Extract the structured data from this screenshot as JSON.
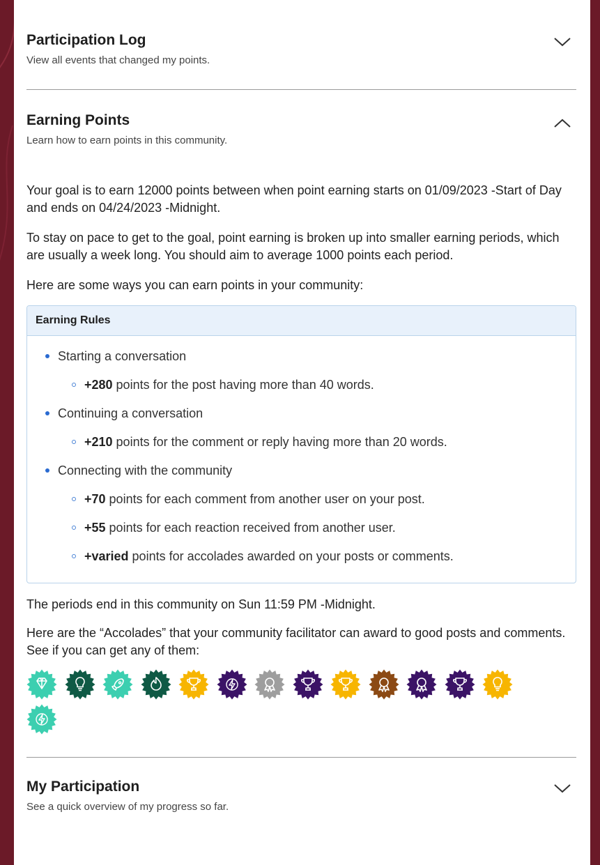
{
  "participation_log": {
    "title": "Participation Log",
    "subtitle": "View all events that changed my points.",
    "state": "collapsed"
  },
  "earning_points": {
    "title": "Earning Points",
    "subtitle": "Learn how to earn points in this community.",
    "state": "expanded",
    "paragraphs": [
      "Your goal is to earn 12000 points between when point earning starts on 01/09/2023 -Start of Day and ends on 04/24/2023 -Midnight.",
      "To stay on pace to get to the goal, point earning is broken up into smaller earning periods, which are usually a week long. You should aim to average 1000 points each period.",
      "Here are some ways you can earn points in your community:"
    ],
    "rules_title": "Earning Rules",
    "rules": [
      {
        "label": "Starting a conversation",
        "items": [
          {
            "amount": "+280",
            "text": " points for the post having more than 40 words."
          }
        ]
      },
      {
        "label": "Continuing a conversation",
        "items": [
          {
            "amount": "+210",
            "text": " points for the comment or reply having more than 20 words."
          }
        ]
      },
      {
        "label": "Connecting with the community",
        "items": [
          {
            "amount": "+70",
            "text": " points for each comment from another user on your post."
          },
          {
            "amount": "+55",
            "text": " points for each reaction received from another user."
          },
          {
            "amount": "+varied",
            "text": " points for accolades awarded on your posts or comments."
          }
        ]
      }
    ],
    "period_end": "The periods end in this community on Sun 11:59 PM -Midnight.",
    "accolades_intro": "Here are the “Accolades” that your community facilitator can award to good posts and comments. See if you can get any of them:",
    "accolades": [
      {
        "icon": "diamond-icon",
        "color": "#3ccfb0"
      },
      {
        "icon": "lightbulb-icon",
        "color": "#0f5a45"
      },
      {
        "icon": "rocket-icon",
        "color": "#3ccfb0"
      },
      {
        "icon": "flame-icon",
        "color": "#0f5a45"
      },
      {
        "icon": "trophy-icon",
        "color": "#f7b500"
      },
      {
        "icon": "lightning-icon",
        "color": "#3b1366"
      },
      {
        "icon": "ribbon-icon",
        "color": "#9e9e9e"
      },
      {
        "icon": "trophy-icon",
        "color": "#3b1366"
      },
      {
        "icon": "trophy-icon",
        "color": "#f7b500"
      },
      {
        "icon": "ribbon-icon",
        "color": "#8c4a14"
      },
      {
        "icon": "ribbon-icon",
        "color": "#3b1366"
      },
      {
        "icon": "trophy-icon",
        "color": "#3b1366"
      },
      {
        "icon": "lightbulb-icon",
        "color": "#f7b500"
      },
      {
        "icon": "lightning-icon",
        "color": "#3ccfb0"
      }
    ]
  },
  "my_participation": {
    "title": "My Participation",
    "subtitle": "See a quick overview of my progress so far.",
    "state": "collapsed"
  }
}
